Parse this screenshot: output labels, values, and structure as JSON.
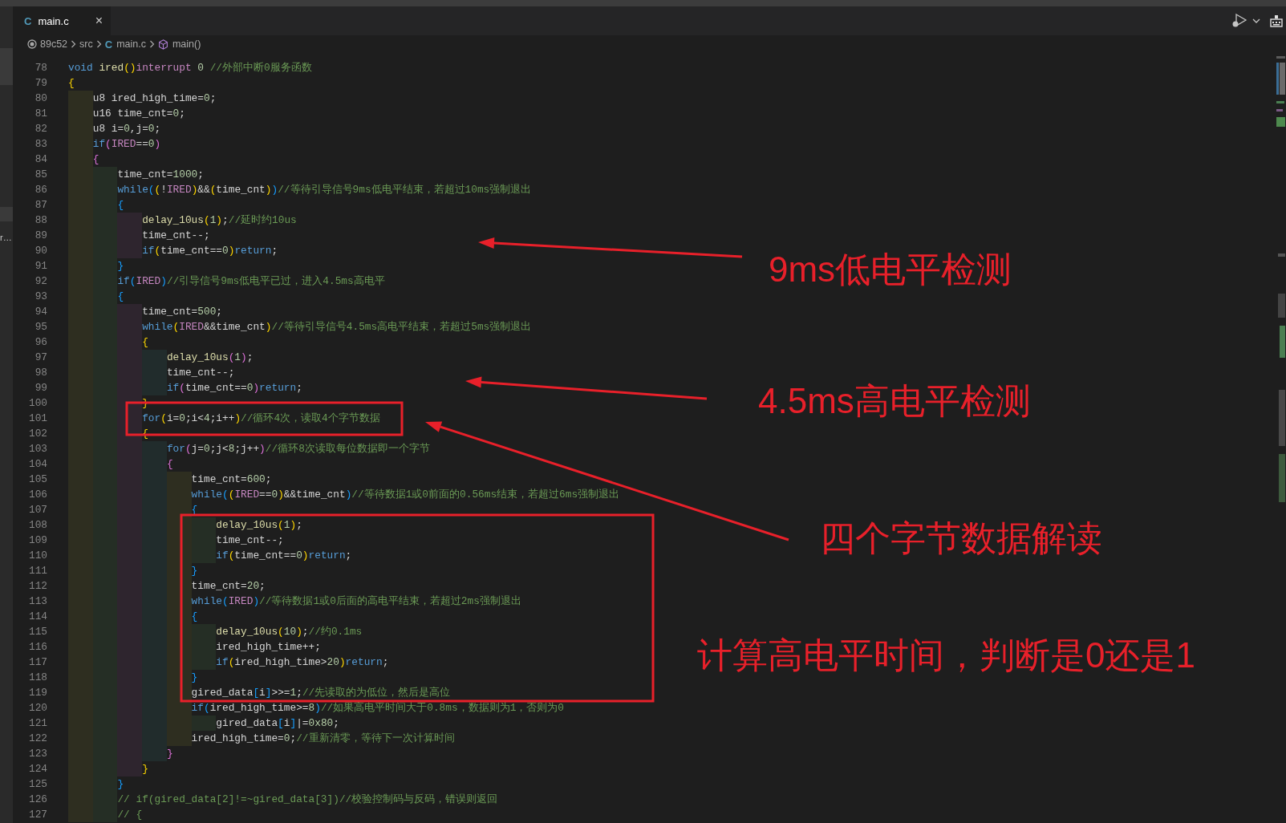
{
  "tab": {
    "icon_letter": "C",
    "label": "main.c",
    "close": "×",
    "selected": true
  },
  "breadcrumbs": [
    {
      "label": "89c52",
      "kind": "folder"
    },
    {
      "label": "src",
      "kind": "folder"
    },
    {
      "label": "main.c",
      "kind": "file",
      "icon_letter": "C"
    },
    {
      "label": "main()",
      "kind": "symbol"
    }
  ],
  "side_panel": {
    "text": "r…"
  },
  "code_lines": [
    {
      "number": "78",
      "tokens": [
        {
          "kind": "keyword",
          "text": "void "
        },
        {
          "kind": "function",
          "text": "ired"
        },
        {
          "kind": "plain",
          "text": "() "
        },
        {
          "kind": "control",
          "text": "interrupt "
        },
        {
          "kind": "number",
          "text": "0 "
        },
        {
          "kind": "comment",
          "text": "//外部中断0服务函数"
        }
      ]
    },
    {
      "number": "79",
      "tokens": [
        {
          "kind": "plain",
          "text": "{"
        }
      ]
    },
    {
      "number": "80",
      "tokens": [
        {
          "kind": "plain",
          "text": "    u8 ired_high_time="
        },
        {
          "kind": "number",
          "text": "0"
        },
        {
          "kind": "plain",
          "text": ";"
        }
      ]
    },
    {
      "number": "81",
      "tokens": [
        {
          "kind": "plain",
          "text": "    u16 time_cnt="
        },
        {
          "kind": "number",
          "text": "0"
        },
        {
          "kind": "plain",
          "text": ";"
        }
      ]
    },
    {
      "number": "82",
      "tokens": [
        {
          "kind": "plain",
          "text": "    u8 i="
        },
        {
          "kind": "number",
          "text": "0"
        },
        {
          "kind": "plain",
          "text": ",j="
        },
        {
          "kind": "number",
          "text": "0"
        },
        {
          "kind": "plain",
          "text": ";"
        }
      ]
    },
    {
      "number": "83",
      "tokens": [
        {
          "kind": "keyword",
          "text": "    if"
        },
        {
          "kind": "plain",
          "text": "("
        },
        {
          "kind": "macro",
          "text": "IRED"
        },
        {
          "kind": "plain",
          "text": "=="
        },
        {
          "kind": "number",
          "text": "0"
        },
        {
          "kind": "plain",
          "text": ")"
        }
      ]
    },
    {
      "number": "84",
      "tokens": [
        {
          "kind": "plain",
          "text": "    {"
        }
      ]
    },
    {
      "number": "85",
      "tokens": [
        {
          "kind": "plain",
          "text": "        time_cnt="
        },
        {
          "kind": "number",
          "text": "1000"
        },
        {
          "kind": "plain",
          "text": ";"
        }
      ]
    },
    {
      "number": "86",
      "tokens": [
        {
          "kind": "keyword",
          "text": "        while"
        },
        {
          "kind": "plain",
          "text": "((!"
        },
        {
          "kind": "macro",
          "text": "IRED"
        },
        {
          "kind": "plain",
          "text": ")&&(time_cnt))"
        },
        {
          "kind": "comment",
          "text": "//等待引导信号9ms低电平结束，若超过10ms强制退出"
        }
      ]
    },
    {
      "number": "87",
      "tokens": [
        {
          "kind": "plain",
          "text": "        {"
        }
      ]
    },
    {
      "number": "88",
      "tokens": [
        {
          "kind": "function",
          "text": "            delay_10us"
        },
        {
          "kind": "plain",
          "text": "("
        },
        {
          "kind": "number",
          "text": "1"
        },
        {
          "kind": "plain",
          "text": ");"
        },
        {
          "kind": "comment",
          "text": "//延时约10us"
        }
      ]
    },
    {
      "number": "89",
      "tokens": [
        {
          "kind": "plain",
          "text": "            time_cnt--;"
        }
      ]
    },
    {
      "number": "90",
      "tokens": [
        {
          "kind": "keyword",
          "text": "            if"
        },
        {
          "kind": "plain",
          "text": "(time_cnt=="
        },
        {
          "kind": "number",
          "text": "0"
        },
        {
          "kind": "plain",
          "text": ")"
        },
        {
          "kind": "keyword",
          "text": "return"
        },
        {
          "kind": "plain",
          "text": ";"
        }
      ]
    },
    {
      "number": "91",
      "tokens": [
        {
          "kind": "plain",
          "text": "        }"
        }
      ]
    },
    {
      "number": "92",
      "tokens": [
        {
          "kind": "keyword",
          "text": "        if"
        },
        {
          "kind": "plain",
          "text": "("
        },
        {
          "kind": "macro",
          "text": "IRED"
        },
        {
          "kind": "plain",
          "text": ")"
        },
        {
          "kind": "comment",
          "text": "//引导信号9ms低电平已过，进入4.5ms高电平"
        }
      ]
    },
    {
      "number": "93",
      "tokens": [
        {
          "kind": "plain",
          "text": "        {"
        }
      ]
    },
    {
      "number": "94",
      "tokens": [
        {
          "kind": "plain",
          "text": "            time_cnt="
        },
        {
          "kind": "number",
          "text": "500"
        },
        {
          "kind": "plain",
          "text": ";"
        }
      ]
    },
    {
      "number": "95",
      "tokens": [
        {
          "kind": "keyword",
          "text": "            while"
        },
        {
          "kind": "plain",
          "text": "("
        },
        {
          "kind": "macro",
          "text": "IRED"
        },
        {
          "kind": "plain",
          "text": "&&time_cnt)"
        },
        {
          "kind": "comment",
          "text": "//等待引导信号4.5ms高电平结束，若超过5ms强制退出"
        }
      ]
    },
    {
      "number": "96",
      "tokens": [
        {
          "kind": "plain",
          "text": "            {"
        }
      ]
    },
    {
      "number": "97",
      "tokens": [
        {
          "kind": "function",
          "text": "                delay_10us"
        },
        {
          "kind": "plain",
          "text": "("
        },
        {
          "kind": "number",
          "text": "1"
        },
        {
          "kind": "plain",
          "text": ");"
        }
      ]
    },
    {
      "number": "98",
      "tokens": [
        {
          "kind": "plain",
          "text": "                time_cnt--;"
        }
      ]
    },
    {
      "number": "99",
      "tokens": [
        {
          "kind": "keyword",
          "text": "                if"
        },
        {
          "kind": "plain",
          "text": "(time_cnt=="
        },
        {
          "kind": "number",
          "text": "0"
        },
        {
          "kind": "plain",
          "text": ")"
        },
        {
          "kind": "keyword",
          "text": "return"
        },
        {
          "kind": "plain",
          "text": ";"
        }
      ]
    },
    {
      "number": "100",
      "tokens": [
        {
          "kind": "plain",
          "text": "            }"
        }
      ]
    },
    {
      "number": "101",
      "tokens": [
        {
          "kind": "keyword",
          "text": "            for"
        },
        {
          "kind": "plain",
          "text": "(i="
        },
        {
          "kind": "number",
          "text": "0"
        },
        {
          "kind": "plain",
          "text": ";i<"
        },
        {
          "kind": "number",
          "text": "4"
        },
        {
          "kind": "plain",
          "text": ";i++)"
        },
        {
          "kind": "comment",
          "text": "//循环4次，读取4个字节数据"
        }
      ]
    },
    {
      "number": "102",
      "tokens": [
        {
          "kind": "plain",
          "text": "            {"
        }
      ]
    },
    {
      "number": "103",
      "tokens": [
        {
          "kind": "keyword",
          "text": "                for"
        },
        {
          "kind": "plain",
          "text": "(j="
        },
        {
          "kind": "number",
          "text": "0"
        },
        {
          "kind": "plain",
          "text": ";j<"
        },
        {
          "kind": "number",
          "text": "8"
        },
        {
          "kind": "plain",
          "text": ";j++)"
        },
        {
          "kind": "comment",
          "text": "//循环8次读取每位数据即一个字节"
        }
      ]
    },
    {
      "number": "104",
      "tokens": [
        {
          "kind": "plain",
          "text": "                {"
        }
      ]
    },
    {
      "number": "105",
      "tokens": [
        {
          "kind": "plain",
          "text": "                    time_cnt="
        },
        {
          "kind": "number",
          "text": "600"
        },
        {
          "kind": "plain",
          "text": ";"
        }
      ]
    },
    {
      "number": "106",
      "tokens": [
        {
          "kind": "keyword",
          "text": "                    while"
        },
        {
          "kind": "plain",
          "text": "(("
        },
        {
          "kind": "macro",
          "text": "IRED"
        },
        {
          "kind": "plain",
          "text": "=="
        },
        {
          "kind": "number",
          "text": "0"
        },
        {
          "kind": "plain",
          "text": ")&&time_cnt)"
        },
        {
          "kind": "comment",
          "text": "//等待数据1或0前面的0.56ms结束，若超过6ms强制退出"
        }
      ]
    },
    {
      "number": "107",
      "tokens": [
        {
          "kind": "plain",
          "text": "                    {"
        }
      ]
    },
    {
      "number": "108",
      "tokens": [
        {
          "kind": "function",
          "text": "                        delay_10us"
        },
        {
          "kind": "plain",
          "text": "("
        },
        {
          "kind": "number",
          "text": "1"
        },
        {
          "kind": "plain",
          "text": ");"
        }
      ]
    },
    {
      "number": "109",
      "tokens": [
        {
          "kind": "plain",
          "text": "                        time_cnt--;"
        }
      ]
    },
    {
      "number": "110",
      "tokens": [
        {
          "kind": "keyword",
          "text": "                        if"
        },
        {
          "kind": "plain",
          "text": "(time_cnt=="
        },
        {
          "kind": "number",
          "text": "0"
        },
        {
          "kind": "plain",
          "text": ")"
        },
        {
          "kind": "keyword",
          "text": "return"
        },
        {
          "kind": "plain",
          "text": ";"
        }
      ]
    },
    {
      "number": "111",
      "tokens": [
        {
          "kind": "plain",
          "text": "                    }"
        }
      ]
    },
    {
      "number": "112",
      "tokens": [
        {
          "kind": "plain",
          "text": "                    time_cnt="
        },
        {
          "kind": "number",
          "text": "20"
        },
        {
          "kind": "plain",
          "text": ";"
        }
      ]
    },
    {
      "number": "113",
      "tokens": [
        {
          "kind": "keyword",
          "text": "                    while"
        },
        {
          "kind": "plain",
          "text": "("
        },
        {
          "kind": "macro",
          "text": "IRED"
        },
        {
          "kind": "plain",
          "text": ")"
        },
        {
          "kind": "comment",
          "text": "//等待数据1或0后面的高电平结束，若超过2ms强制退出"
        }
      ]
    },
    {
      "number": "114",
      "tokens": [
        {
          "kind": "plain",
          "text": "                    {"
        }
      ]
    },
    {
      "number": "115",
      "tokens": [
        {
          "kind": "function",
          "text": "                        delay_10us"
        },
        {
          "kind": "plain",
          "text": "("
        },
        {
          "kind": "number",
          "text": "10"
        },
        {
          "kind": "plain",
          "text": ");"
        },
        {
          "kind": "comment",
          "text": "//约0.1ms"
        }
      ]
    },
    {
      "number": "116",
      "tokens": [
        {
          "kind": "plain",
          "text": "                        ired_high_time++;"
        }
      ]
    },
    {
      "number": "117",
      "tokens": [
        {
          "kind": "keyword",
          "text": "                        if"
        },
        {
          "kind": "plain",
          "text": "(ired_high_time>"
        },
        {
          "kind": "number",
          "text": "20"
        },
        {
          "kind": "plain",
          "text": ")"
        },
        {
          "kind": "keyword",
          "text": "return"
        },
        {
          "kind": "plain",
          "text": ";"
        }
      ]
    },
    {
      "number": "118",
      "tokens": [
        {
          "kind": "plain",
          "text": "                    }"
        }
      ]
    },
    {
      "number": "119",
      "tokens": [
        {
          "kind": "plain",
          "text": "                    gired_data[i]>>="
        },
        {
          "kind": "number",
          "text": "1"
        },
        {
          "kind": "plain",
          "text": ";"
        },
        {
          "kind": "comment",
          "text": "//先读取的为低位，然后是高位"
        }
      ]
    },
    {
      "number": "120",
      "tokens": [
        {
          "kind": "keyword",
          "text": "                    if"
        },
        {
          "kind": "plain",
          "text": "(ired_high_time>="
        },
        {
          "kind": "number",
          "text": "8"
        },
        {
          "kind": "plain",
          "text": ")"
        },
        {
          "kind": "comment",
          "text": "//如果高电平时间大于0.8ms，数据则为1，否则为0"
        }
      ]
    },
    {
      "number": "121",
      "tokens": [
        {
          "kind": "plain",
          "text": "                        gired_data[i]|="
        },
        {
          "kind": "number",
          "text": "0x80"
        },
        {
          "kind": "plain",
          "text": ";"
        }
      ]
    },
    {
      "number": "122",
      "tokens": [
        {
          "kind": "plain",
          "text": "                    ired_high_time="
        },
        {
          "kind": "number",
          "text": "0"
        },
        {
          "kind": "plain",
          "text": ";"
        },
        {
          "kind": "comment",
          "text": "//重新清零，等待下一次计算时间"
        }
      ]
    },
    {
      "number": "123",
      "tokens": [
        {
          "kind": "plain",
          "text": "                }"
        }
      ]
    },
    {
      "number": "124",
      "tokens": [
        {
          "kind": "plain",
          "text": "            }"
        }
      ]
    },
    {
      "number": "125",
      "tokens": [
        {
          "kind": "plain",
          "text": "        }"
        }
      ]
    },
    {
      "number": "126",
      "tokens": [
        {
          "kind": "comment",
          "text": "        // if(gired_data[2]!=~gired_data[3])//校验控制码与反码，错误则返回"
        }
      ]
    },
    {
      "number": "127",
      "tokens": [
        {
          "kind": "comment",
          "text": "        // {"
        }
      ]
    }
  ],
  "annotations": [
    {
      "text": "9ms低电平检测"
    },
    {
      "text": "4.5ms高电平检测"
    },
    {
      "text": "四个字节数据解读"
    },
    {
      "text": "计算高电平时间，判断是0还是1"
    }
  ]
}
